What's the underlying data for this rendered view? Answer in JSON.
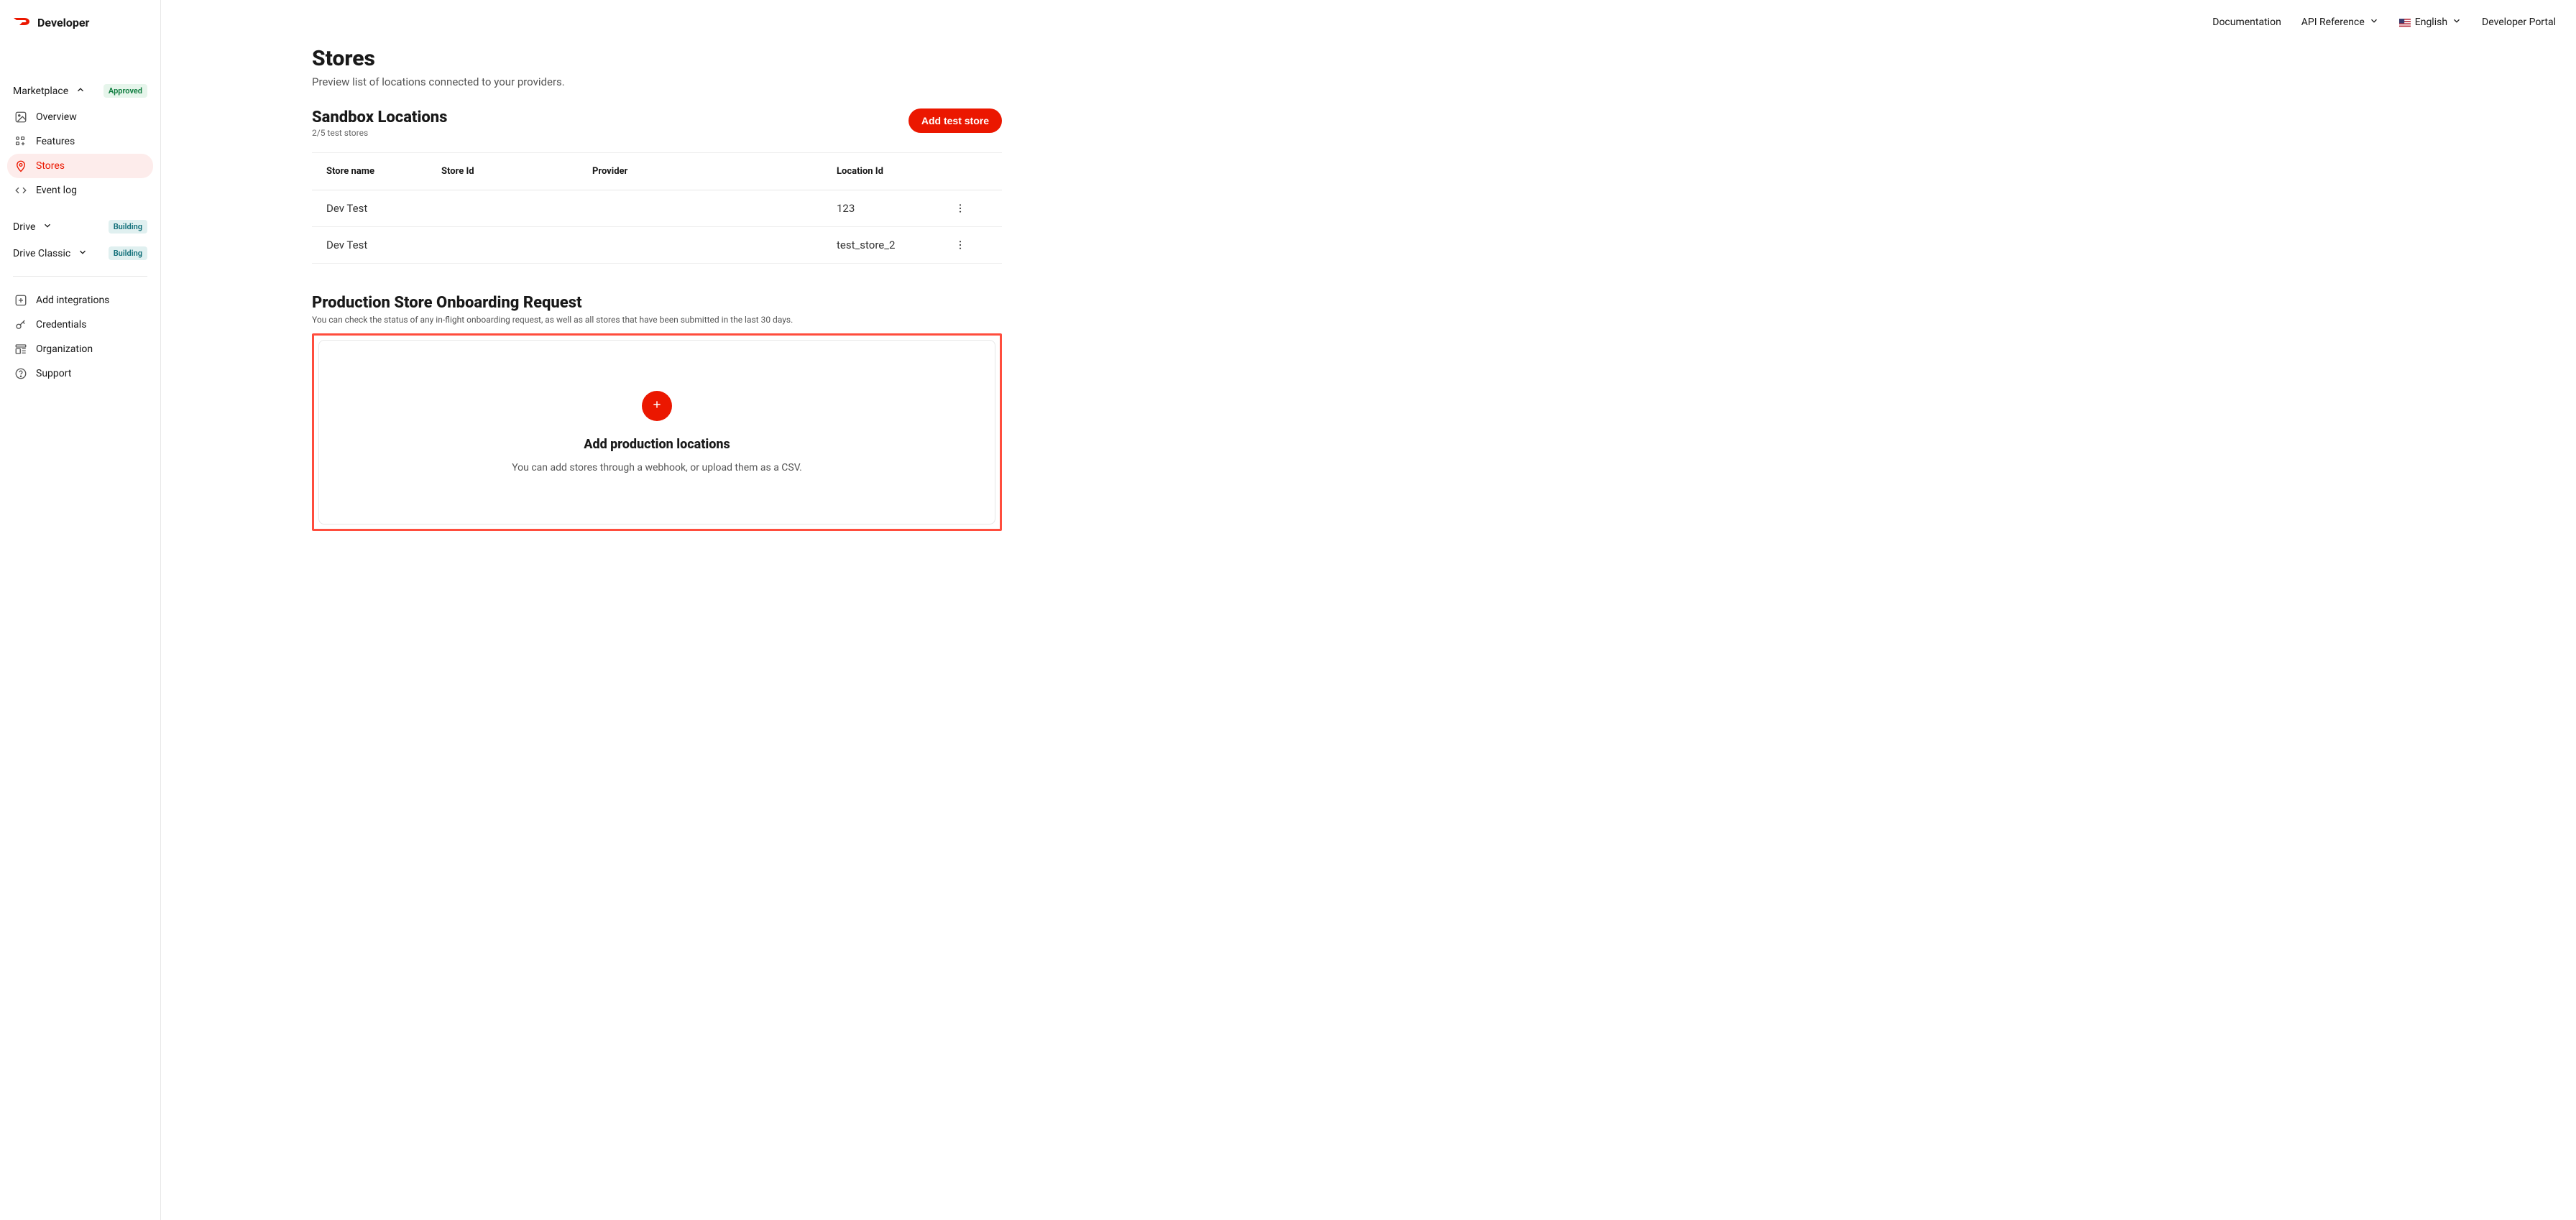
{
  "brand": {
    "text": "Developer"
  },
  "topnav": {
    "documentation": "Documentation",
    "api_reference": "API Reference",
    "language": "English",
    "portal": "Developer Portal"
  },
  "sidebar": {
    "groups": [
      {
        "title": "Marketplace",
        "badge": "Approved",
        "badge_style": "approved",
        "expanded": true
      },
      {
        "title": "Drive",
        "badge": "Building",
        "badge_style": "building",
        "expanded": false
      },
      {
        "title": "Drive Classic",
        "badge": "Building",
        "badge_style": "building",
        "expanded": false
      }
    ],
    "marketplace_items": [
      {
        "label": "Overview"
      },
      {
        "label": "Features"
      },
      {
        "label": "Stores"
      },
      {
        "label": "Event log"
      }
    ],
    "footer_items": [
      {
        "label": "Add integrations"
      },
      {
        "label": "Credentials"
      },
      {
        "label": "Organization"
      },
      {
        "label": "Support"
      }
    ]
  },
  "page": {
    "title": "Stores",
    "subtitle": "Preview list of locations connected to your providers."
  },
  "sandbox": {
    "title": "Sandbox Locations",
    "count_text": "2/5 test stores",
    "add_button": "Add test store",
    "columns": [
      "Store name",
      "Store Id",
      "Provider",
      "Location Id"
    ],
    "rows": [
      {
        "store_name": "Dev Test",
        "store_id": "",
        "provider": "",
        "location_id": "123"
      },
      {
        "store_name": "Dev Test",
        "store_id": "",
        "provider": "",
        "location_id": "test_store_2"
      }
    ]
  },
  "production": {
    "title": "Production Store Onboarding Request",
    "subtitle": "You can check the status of any in-flight onboarding request, as well as all stores that have been submitted in the last 30 days.",
    "card_title": "Add production locations",
    "card_subtitle": "You can add stores through a webhook, or upload them as a CSV."
  }
}
